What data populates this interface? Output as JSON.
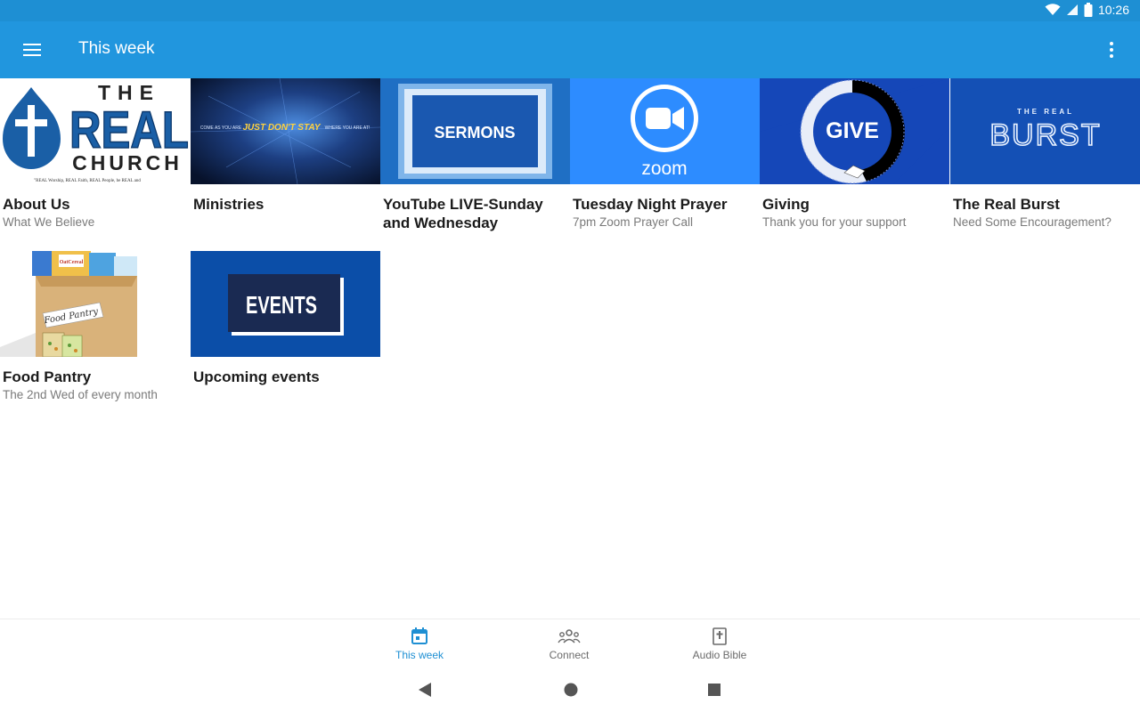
{
  "status_bar": {
    "time": "10:26"
  },
  "app_bar": {
    "title": "This week"
  },
  "tiles": [
    {
      "title": "About Us",
      "subtitle": "What We Believe",
      "image_text": {
        "the": "THE",
        "real": "REAL",
        "church": "CHURCH",
        "tagline": "\"REAL Worship, REAL Faith, REAL People, be REAL and"
      }
    },
    {
      "title": "Ministries",
      "subtitle": "",
      "image_text": {
        "left": "COME AS YOU ARE",
        "mid": "JUST DON'T STAY",
        "right": "WHERE YOU ARE AT!"
      }
    },
    {
      "title": "YouTube LIVE-Sunday and Wednesday",
      "subtitle": "",
      "image_text": {
        "label": "SERMONS"
      }
    },
    {
      "title": "Tuesday Night Prayer",
      "subtitle": "7pm Zoom Prayer Call",
      "image_text": {
        "label": "zoom"
      }
    },
    {
      "title": "Giving",
      "subtitle": "Thank you for your support",
      "image_text": {
        "label": "GIVE"
      }
    },
    {
      "title": "The Real Burst",
      "subtitle": "Need Some Encouragement?",
      "image_text": {
        "small": "THE REAL",
        "big": "BURST"
      }
    },
    {
      "title": "Food Pantry",
      "subtitle": "The 2nd Wed of every month",
      "image_text": {
        "label": "Food Pantry",
        "box": "OatCereal"
      }
    },
    {
      "title": "Upcoming events",
      "subtitle": "",
      "image_text": {
        "label": "EVENTS"
      }
    }
  ],
  "bottom_nav": [
    {
      "label": "This week",
      "icon": "calendar-icon",
      "active": true
    },
    {
      "label": "Connect",
      "icon": "group-icon",
      "active": false
    },
    {
      "label": "Audio Bible",
      "icon": "bible-icon",
      "active": false
    }
  ],
  "colors": {
    "primary": "#2196de",
    "status": "#1e8fd3",
    "active": "#1e8fd3"
  }
}
